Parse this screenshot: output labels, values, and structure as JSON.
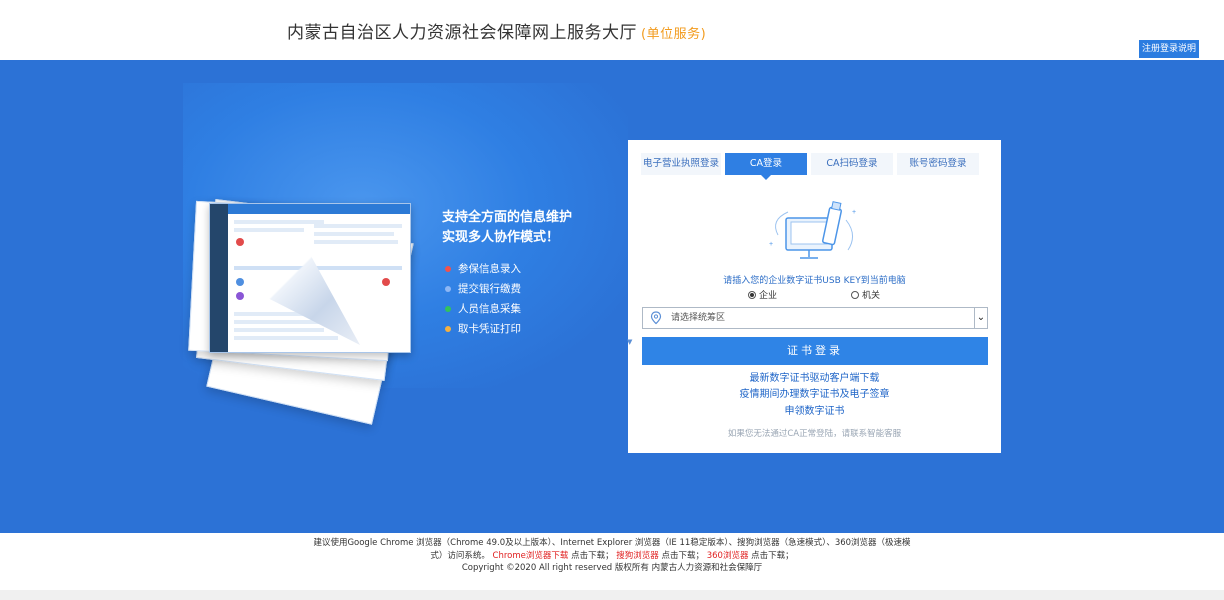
{
  "header": {
    "title": "内蒙古自治区人力资源社会保障网上服务大厅",
    "subtitle": "(单位服务)",
    "help_button": "注册登录说明"
  },
  "hero": {
    "title_line1": "支持全方面的信息维护",
    "title_line2": "实现多人协作模式！",
    "features": [
      {
        "label": "参保信息录入",
        "color": "#f2524b"
      },
      {
        "label": "提交银行缴费",
        "color": "#8fb7f4"
      },
      {
        "label": "人员信息采集",
        "color": "#33c25c"
      },
      {
        "label": "取卡凭证打印",
        "color": "#f5b041"
      }
    ]
  },
  "login": {
    "tabs": [
      "电子营业执照登录",
      "CA登录",
      "CA扫码登录",
      "账号密码登录"
    ],
    "active_tab": "CA登录",
    "hint": "请插入您的企业数字证书USB KEY到当前电脑",
    "radio_options": [
      "企业",
      "机关"
    ],
    "selected_radio": "企业",
    "region_placeholder": "请选择统筹区",
    "submit_label": "证书登录",
    "links": [
      "最新数字证书驱动客户端下载",
      "疫情期间办理数字证书及电子签章",
      "申领数字证书"
    ],
    "note": "如果您无法通过CA正常登陆，请联系智能客服"
  },
  "footer": {
    "line1": "建议使用Google Chrome 浏览器（Chrome 49.0及以上版本）、Internet Explorer 浏览器（IE 11稳定版本）、搜狗浏览器（急速模式）、360浏览器（极速模",
    "line2_prefix": "式）访问系统。",
    "chrome_link": "Chrome浏览器下载",
    "click_download": "点击下载；",
    "sogou_link": "搜狗浏览器",
    "link_360": "360浏览器",
    "copyright": "Copyright ©2020 All right reserved 版权所有 内蒙古人力资源和社会保障厅"
  },
  "colors": {
    "banner": "#2c72d6",
    "accent": "#2f84e6",
    "subtitle": "#f29b1d",
    "footer_link": "#e02020"
  }
}
